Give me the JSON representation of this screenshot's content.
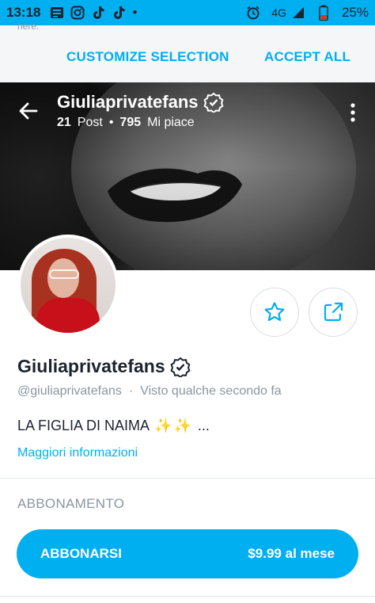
{
  "status_bar": {
    "time": "13:18",
    "dot": "•",
    "network": "4G",
    "battery": "25%",
    "left_icons": [
      "news-icon",
      "instagram-icon",
      "tiktok-icon",
      "tiktok-icon"
    ],
    "right_icons": [
      "alarm-icon",
      "signal-icon",
      "battery-icon"
    ]
  },
  "cookie_banner": {
    "cut_off_text": "here.",
    "customize_label": "CUSTOMIZE SELECTION",
    "accept_label": "ACCEPT ALL"
  },
  "cover": {
    "name": "Giuliaprivatefans",
    "posts_count": "21",
    "posts_label": "Post",
    "separator": "•",
    "likes_count": "795",
    "likes_label": "Mi piace"
  },
  "profile": {
    "name": "Giuliaprivatefans",
    "handle": "@giuliaprivatefans",
    "separator": "·",
    "last_seen": "Visto qualche secondo fa",
    "bio": "LA FIGLIA DI NAIMA",
    "bio_sparkles": "✨✨",
    "bio_ellipsis": "...",
    "more_info": "Maggiori informazioni"
  },
  "subscription": {
    "section_title": "ABBONAMENTO",
    "button_label": "ABBONARSI",
    "price": "$9.99 al mese"
  },
  "colors": {
    "accent": "#00aff0",
    "text": "#1c2430",
    "muted": "#8a96a3"
  }
}
